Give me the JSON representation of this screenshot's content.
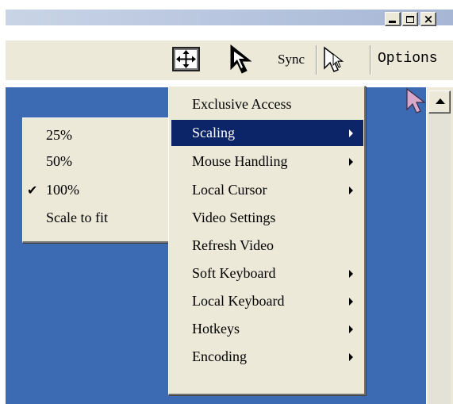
{
  "window": {
    "controls": {
      "minimize_icon": "minimize-icon",
      "maximize_icon": "maximize-icon",
      "close_icon": "close-icon"
    },
    "colors": {
      "titlebar": "#b6c4de",
      "toolbar": "#ece9d8",
      "desktop": "#3c6bb3",
      "menu_highlight": "#0c2468"
    }
  },
  "toolbar": {
    "fit_icon": "fit-to-window-icon",
    "cursor_icon": "arrow-cursor-icon",
    "sync_label": "Sync",
    "mouse_icon": "outline-cursor-icon",
    "options_label": "Options"
  },
  "main_menu": {
    "items": [
      {
        "label": "Exclusive Access",
        "submenu": false
      },
      {
        "label": "Scaling",
        "submenu": true,
        "highlighted": true
      },
      {
        "label": "Mouse Handling",
        "submenu": true
      },
      {
        "label": "Local Cursor",
        "submenu": true
      },
      {
        "label": "Video Settings",
        "submenu": false
      },
      {
        "label": "Refresh Video",
        "submenu": false
      },
      {
        "label": "Soft Keyboard",
        "submenu": true
      },
      {
        "label": "Local Keyboard",
        "submenu": true
      },
      {
        "label": "Hotkeys",
        "submenu": true
      },
      {
        "label": "Encoding",
        "submenu": true
      }
    ]
  },
  "scaling_menu": {
    "items": [
      {
        "label": "25%",
        "checked": false
      },
      {
        "label": "50%",
        "checked": false
      },
      {
        "label": "100%",
        "checked": true
      },
      {
        "label": "Scale to fit",
        "checked": false
      }
    ],
    "check_mark": "✔"
  },
  "remote": {
    "cursor_icon": "remote-cursor-icon"
  }
}
